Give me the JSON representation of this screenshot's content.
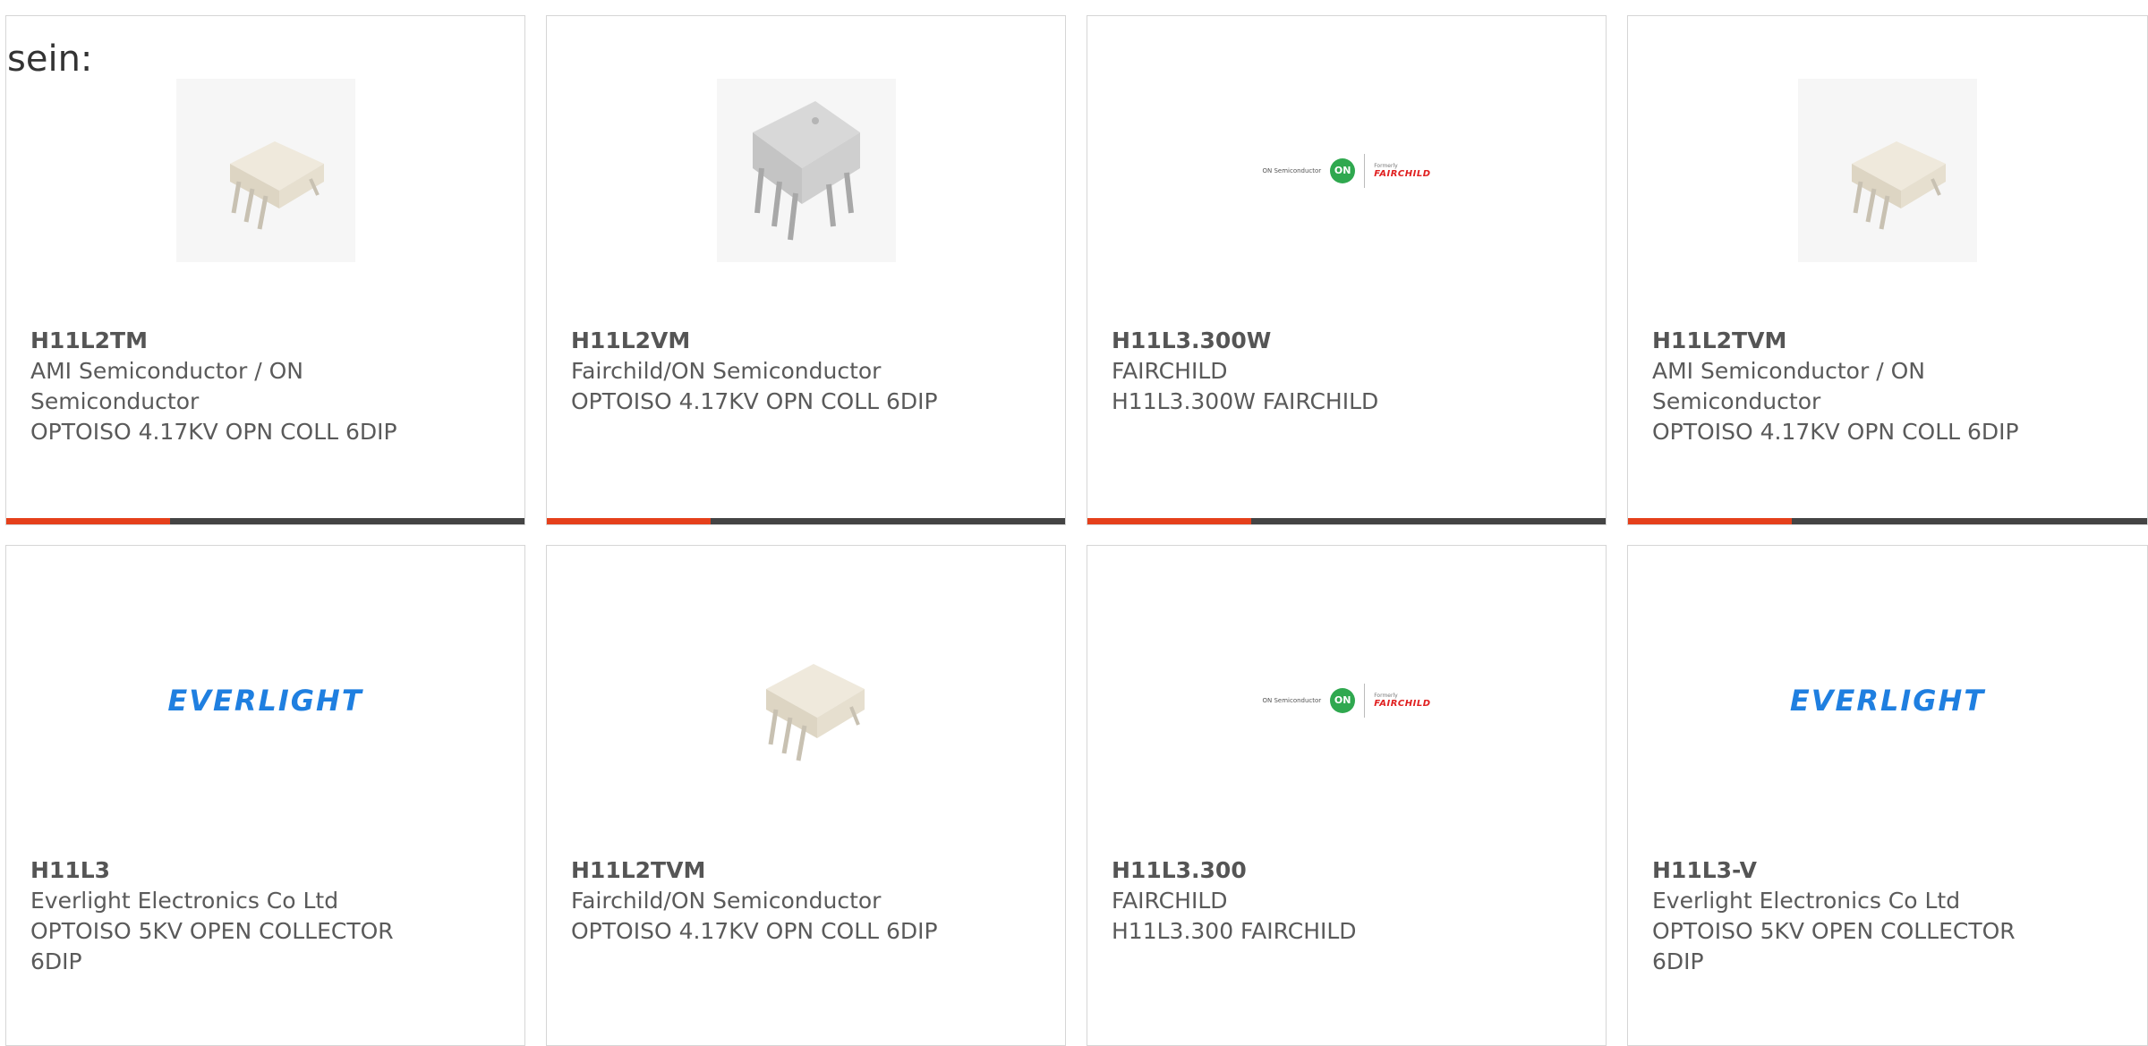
{
  "heading": "sein:",
  "colors": {
    "accent_bar": "#e5401b",
    "bar_base": "#444444",
    "everlight_blue": "#1f7fe0",
    "on_green": "#2fa84f",
    "fairchild_red": "#e02020"
  },
  "cards": [
    {
      "part_number": "H11L2TM",
      "manufacturer_line1": "AMI Semiconductor / ON",
      "manufacturer_line2": "Semiconductor",
      "description": "OPTOISO 4.17KV OPN COLL 6DIP",
      "image": "dip6-chip-small"
    },
    {
      "part_number": "H11L2VM",
      "manufacturer_line1": "Fairchild/ON Semiconductor",
      "manufacturer_line2": "",
      "description": "OPTOISO 4.17KV OPN COLL 6DIP",
      "image": "dip6-chip-large"
    },
    {
      "part_number": "H11L3.300W",
      "manufacturer_line1": "FAIRCHILD",
      "manufacturer_line2": "",
      "description": "H11L3.300W FAIRCHILD",
      "image": "on-fairchild-logo",
      "logo": {
        "on_text": "ON Semiconductor",
        "on_mark": "ON",
        "formerly": "Formerly",
        "fairchild": "FAIRCHILD"
      }
    },
    {
      "part_number": "H11L2TVM",
      "manufacturer_line1": "AMI Semiconductor / ON",
      "manufacturer_line2": "Semiconductor",
      "description": "OPTOISO 4.17KV OPN COLL 6DIP",
      "image": "dip6-chip-small"
    },
    {
      "part_number": "H11L3",
      "manufacturer_line1": "Everlight Electronics Co Ltd",
      "manufacturer_line2": "",
      "description": "OPTOISO 5KV OPEN COLLECTOR",
      "description_line2": "6DIP",
      "image": "everlight-logo",
      "logo_text": "EVERLIGHT"
    },
    {
      "part_number": "H11L2TVM",
      "manufacturer_line1": "Fairchild/ON Semiconductor",
      "manufacturer_line2": "",
      "description": "OPTOISO 4.17KV OPN COLL 6DIP",
      "image": "dip6-chip-small"
    },
    {
      "part_number": "H11L3.300",
      "manufacturer_line1": "FAIRCHILD",
      "manufacturer_line2": "",
      "description": "H11L3.300 FAIRCHILD",
      "image": "on-fairchild-logo",
      "logo": {
        "on_text": "ON Semiconductor",
        "on_mark": "ON",
        "formerly": "Formerly",
        "fairchild": "FAIRCHILD"
      }
    },
    {
      "part_number": "H11L3-V",
      "manufacturer_line1": "Everlight Electronics Co Ltd",
      "manufacturer_line2": "",
      "description": "OPTOISO 5KV OPEN COLLECTOR",
      "description_line2": "6DIP",
      "image": "everlight-logo",
      "logo_text": "EVERLIGHT"
    }
  ]
}
